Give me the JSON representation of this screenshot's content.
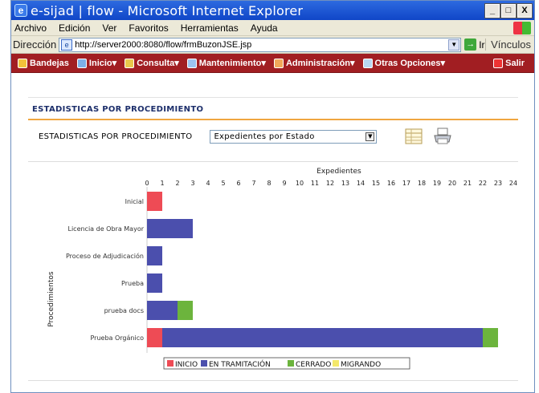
{
  "window": {
    "title": "e-sijad | flow - Microsoft Internet Explorer",
    "minimize": "_",
    "maximize": "□",
    "close": "X"
  },
  "menu": [
    "Archivo",
    "Edición",
    "Ver",
    "Favoritos",
    "Herramientas",
    "Ayuda"
  ],
  "address": {
    "label": "Dirección",
    "url": "http://server2000:8080/flow/frmBuzonJSE.jsp",
    "go": "Ir",
    "links": "Vínculos"
  },
  "nav": {
    "items": [
      "Bandejas",
      "Inicio",
      "Consulta",
      "Mantenimiento",
      "Administración",
      "Otras Opciones"
    ],
    "salir": "Salir"
  },
  "panel": {
    "title": "ESTADISTICAS POR PROCEDIMIENTO",
    "label": "ESTADISTICAS POR PROCEDIMIENTO",
    "select_value": "Expedientes por Estado"
  },
  "colors": {
    "inicio": "#ee4b55",
    "tramitacion": "#4b4fad",
    "cerrado": "#6cb43d",
    "migrando": "#f4e86a"
  },
  "chart_data": {
    "type": "bar",
    "orientation": "horizontal",
    "stacked": true,
    "xlabel": "Expedientes",
    "ylabel": "Procedimientos",
    "xlim": [
      0,
      24
    ],
    "xticks": [
      0,
      1,
      2,
      3,
      4,
      5,
      6,
      7,
      8,
      9,
      10,
      11,
      12,
      13,
      14,
      15,
      16,
      17,
      18,
      19,
      20,
      21,
      22,
      23,
      24
    ],
    "categories": [
      "Inicial",
      "Licencia de Obra Mayor",
      "Proceso de Adjudicación",
      "Prueba",
      "prueba docs",
      "Prueba Orgánico"
    ],
    "series": [
      {
        "name": "INICIO",
        "values": [
          1,
          0,
          0,
          0,
          0,
          1
        ]
      },
      {
        "name": "EN TRAMITACIÓN",
        "values": [
          0,
          3,
          1,
          1,
          2,
          21
        ]
      },
      {
        "name": "CERRADO",
        "values": [
          0,
          0,
          0,
          0,
          1,
          1
        ]
      },
      {
        "name": "MIGRANDO",
        "values": [
          0,
          0,
          0,
          0,
          0,
          0
        ]
      }
    ],
    "legend_position": "bottom"
  }
}
